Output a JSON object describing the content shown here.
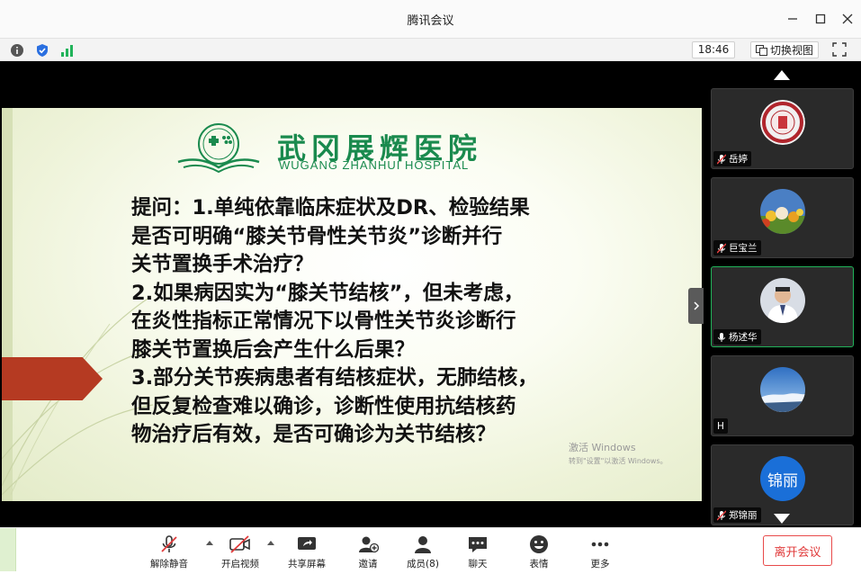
{
  "window": {
    "title": "腾讯会议"
  },
  "infobar": {
    "time": "18:46",
    "switch_view_label": "切换视图"
  },
  "slide": {
    "hospital_name_cn": "武冈展辉医院",
    "hospital_name_en": "WUGANG ZHANHUI HOSPITAL",
    "lines": [
      "提问：1.单纯依靠临床症状及DR、检验结果",
      "是否可明确“膝关节骨性关节炎”诊断并行",
      "关节置换手术治疗？",
      "2.如果病因实为“膝关节结核”，但未考虑，",
      "在炎性指标正常情况下以骨性关节炎诊断行",
      "膝关节置换后会产生什么后果？",
      "3.部分关节疾病患者有结核症状，无肺结核，",
      "但反复检查难以确诊，诊断性使用抗结核药",
      "物治疗后有效，是否可确诊为关节结核？"
    ],
    "watermark_line1": "激活 Windows",
    "watermark_line2": "转到\"设置\"以激活 Windows。"
  },
  "participants": [
    {
      "name": "岳婷",
      "mic": "muted",
      "avatar": "university-seal"
    },
    {
      "name": "巨宝兰",
      "mic": "muted",
      "avatar": "flowers-photo"
    },
    {
      "name": "杨述华",
      "mic": "on",
      "avatar": "doctor-photo",
      "active": true
    },
    {
      "name": "H",
      "mic": "none",
      "avatar": "sky-photo"
    },
    {
      "name": "郑锦丽",
      "mic": "muted",
      "avatar": "text",
      "avatar_text": "锦丽"
    }
  ],
  "toolbar": {
    "unmute": "解除静音",
    "start_video": "开启视频",
    "share_screen": "共享屏幕",
    "invite": "邀请",
    "members": "成员(8)",
    "chat": "聊天",
    "reactions": "表情",
    "more": "更多",
    "leave": "离开会议"
  },
  "colors": {
    "accent_green": "#21b35a",
    "leave_red": "#e03a3a",
    "hospital_green": "#1a8a4e",
    "slide_arrow": "#b53a22"
  }
}
